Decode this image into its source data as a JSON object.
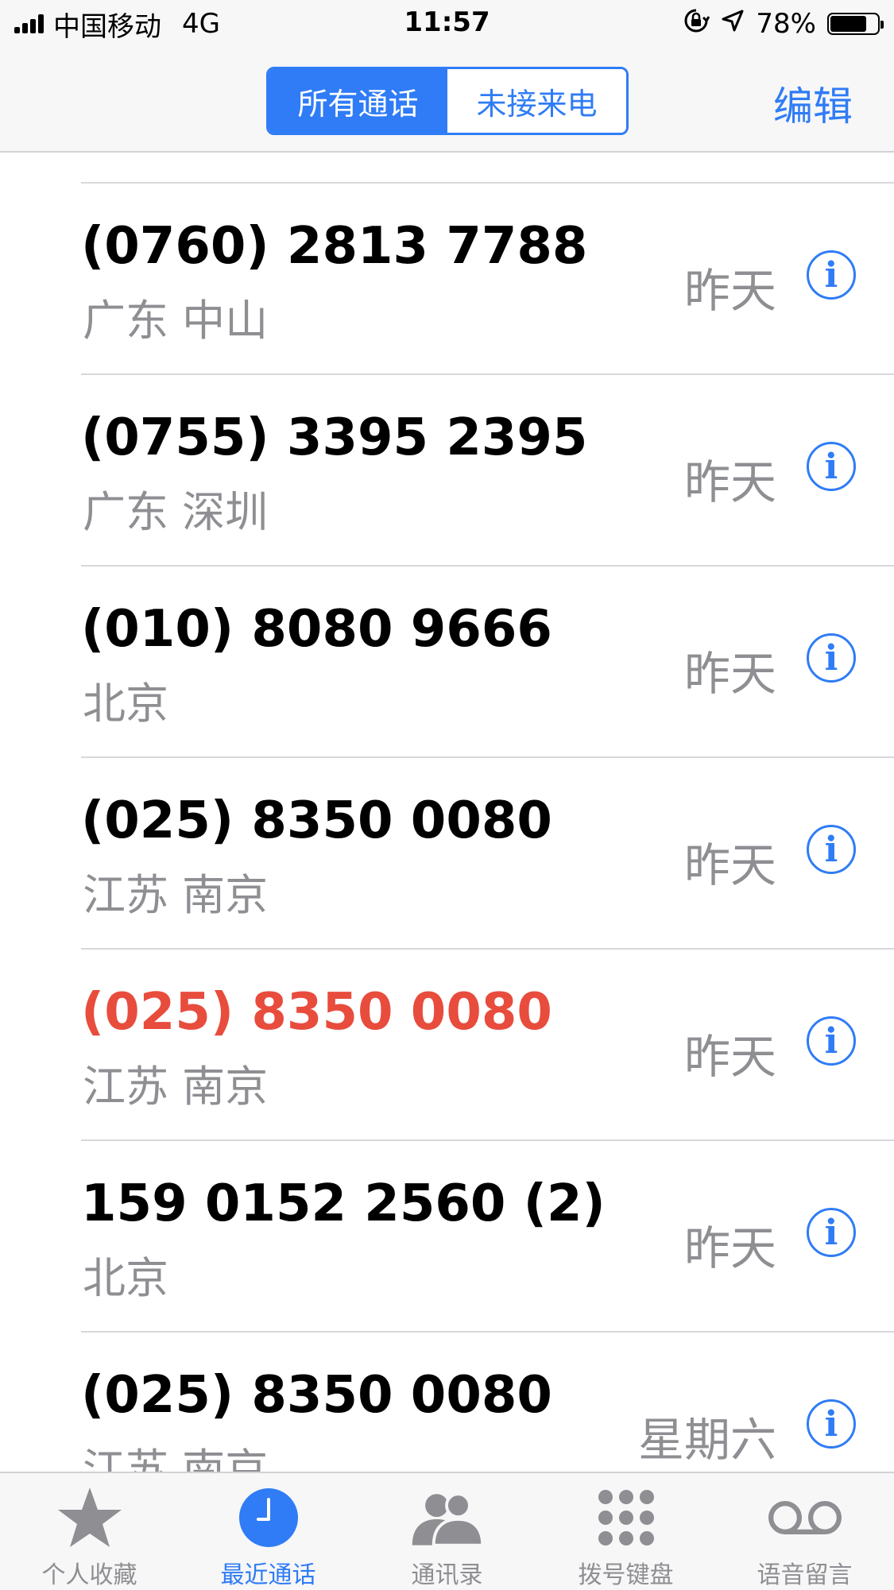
{
  "status_bar": {
    "carrier": "中国移动",
    "network": "4G",
    "time": "11:57",
    "battery_percent": "78%",
    "battery_level": 0.78
  },
  "nav": {
    "segments": [
      {
        "label": "所有通话",
        "active": true
      },
      {
        "label": "未接来电",
        "active": false
      }
    ],
    "edit_label": "编辑"
  },
  "calls": [
    {
      "number": "(0760) 2813 7788",
      "location": "广东 中山",
      "date": "昨天",
      "missed": false
    },
    {
      "number": "(0755) 3395 2395",
      "location": "广东 深圳",
      "date": "昨天",
      "missed": false
    },
    {
      "number": "(010) 8080 9666",
      "location": "北京",
      "date": "昨天",
      "missed": false
    },
    {
      "number": "(025) 8350 0080",
      "location": "江苏 南京",
      "date": "昨天",
      "missed": false
    },
    {
      "number": "(025) 8350 0080",
      "location": "江苏 南京",
      "date": "昨天",
      "missed": true
    },
    {
      "number": "159 0152 2560 (2)",
      "location": "北京",
      "date": "昨天",
      "missed": false
    },
    {
      "number": "(025) 8350 0080",
      "location": "江苏 南京",
      "date": "星期六",
      "missed": false
    }
  ],
  "tabs": [
    {
      "label": "个人收藏",
      "icon": "star-icon",
      "active": false
    },
    {
      "label": "最近通话",
      "icon": "clock-icon",
      "active": true
    },
    {
      "label": "通讯录",
      "icon": "contacts-icon",
      "active": false
    },
    {
      "label": "拨号键盘",
      "icon": "keypad-icon",
      "active": false
    },
    {
      "label": "语音留言",
      "icon": "voicemail-icon",
      "active": false
    }
  ],
  "colors": {
    "accent": "#2f7cf6",
    "missed": "#e84c3d",
    "secondary_text": "#8e8e93"
  }
}
